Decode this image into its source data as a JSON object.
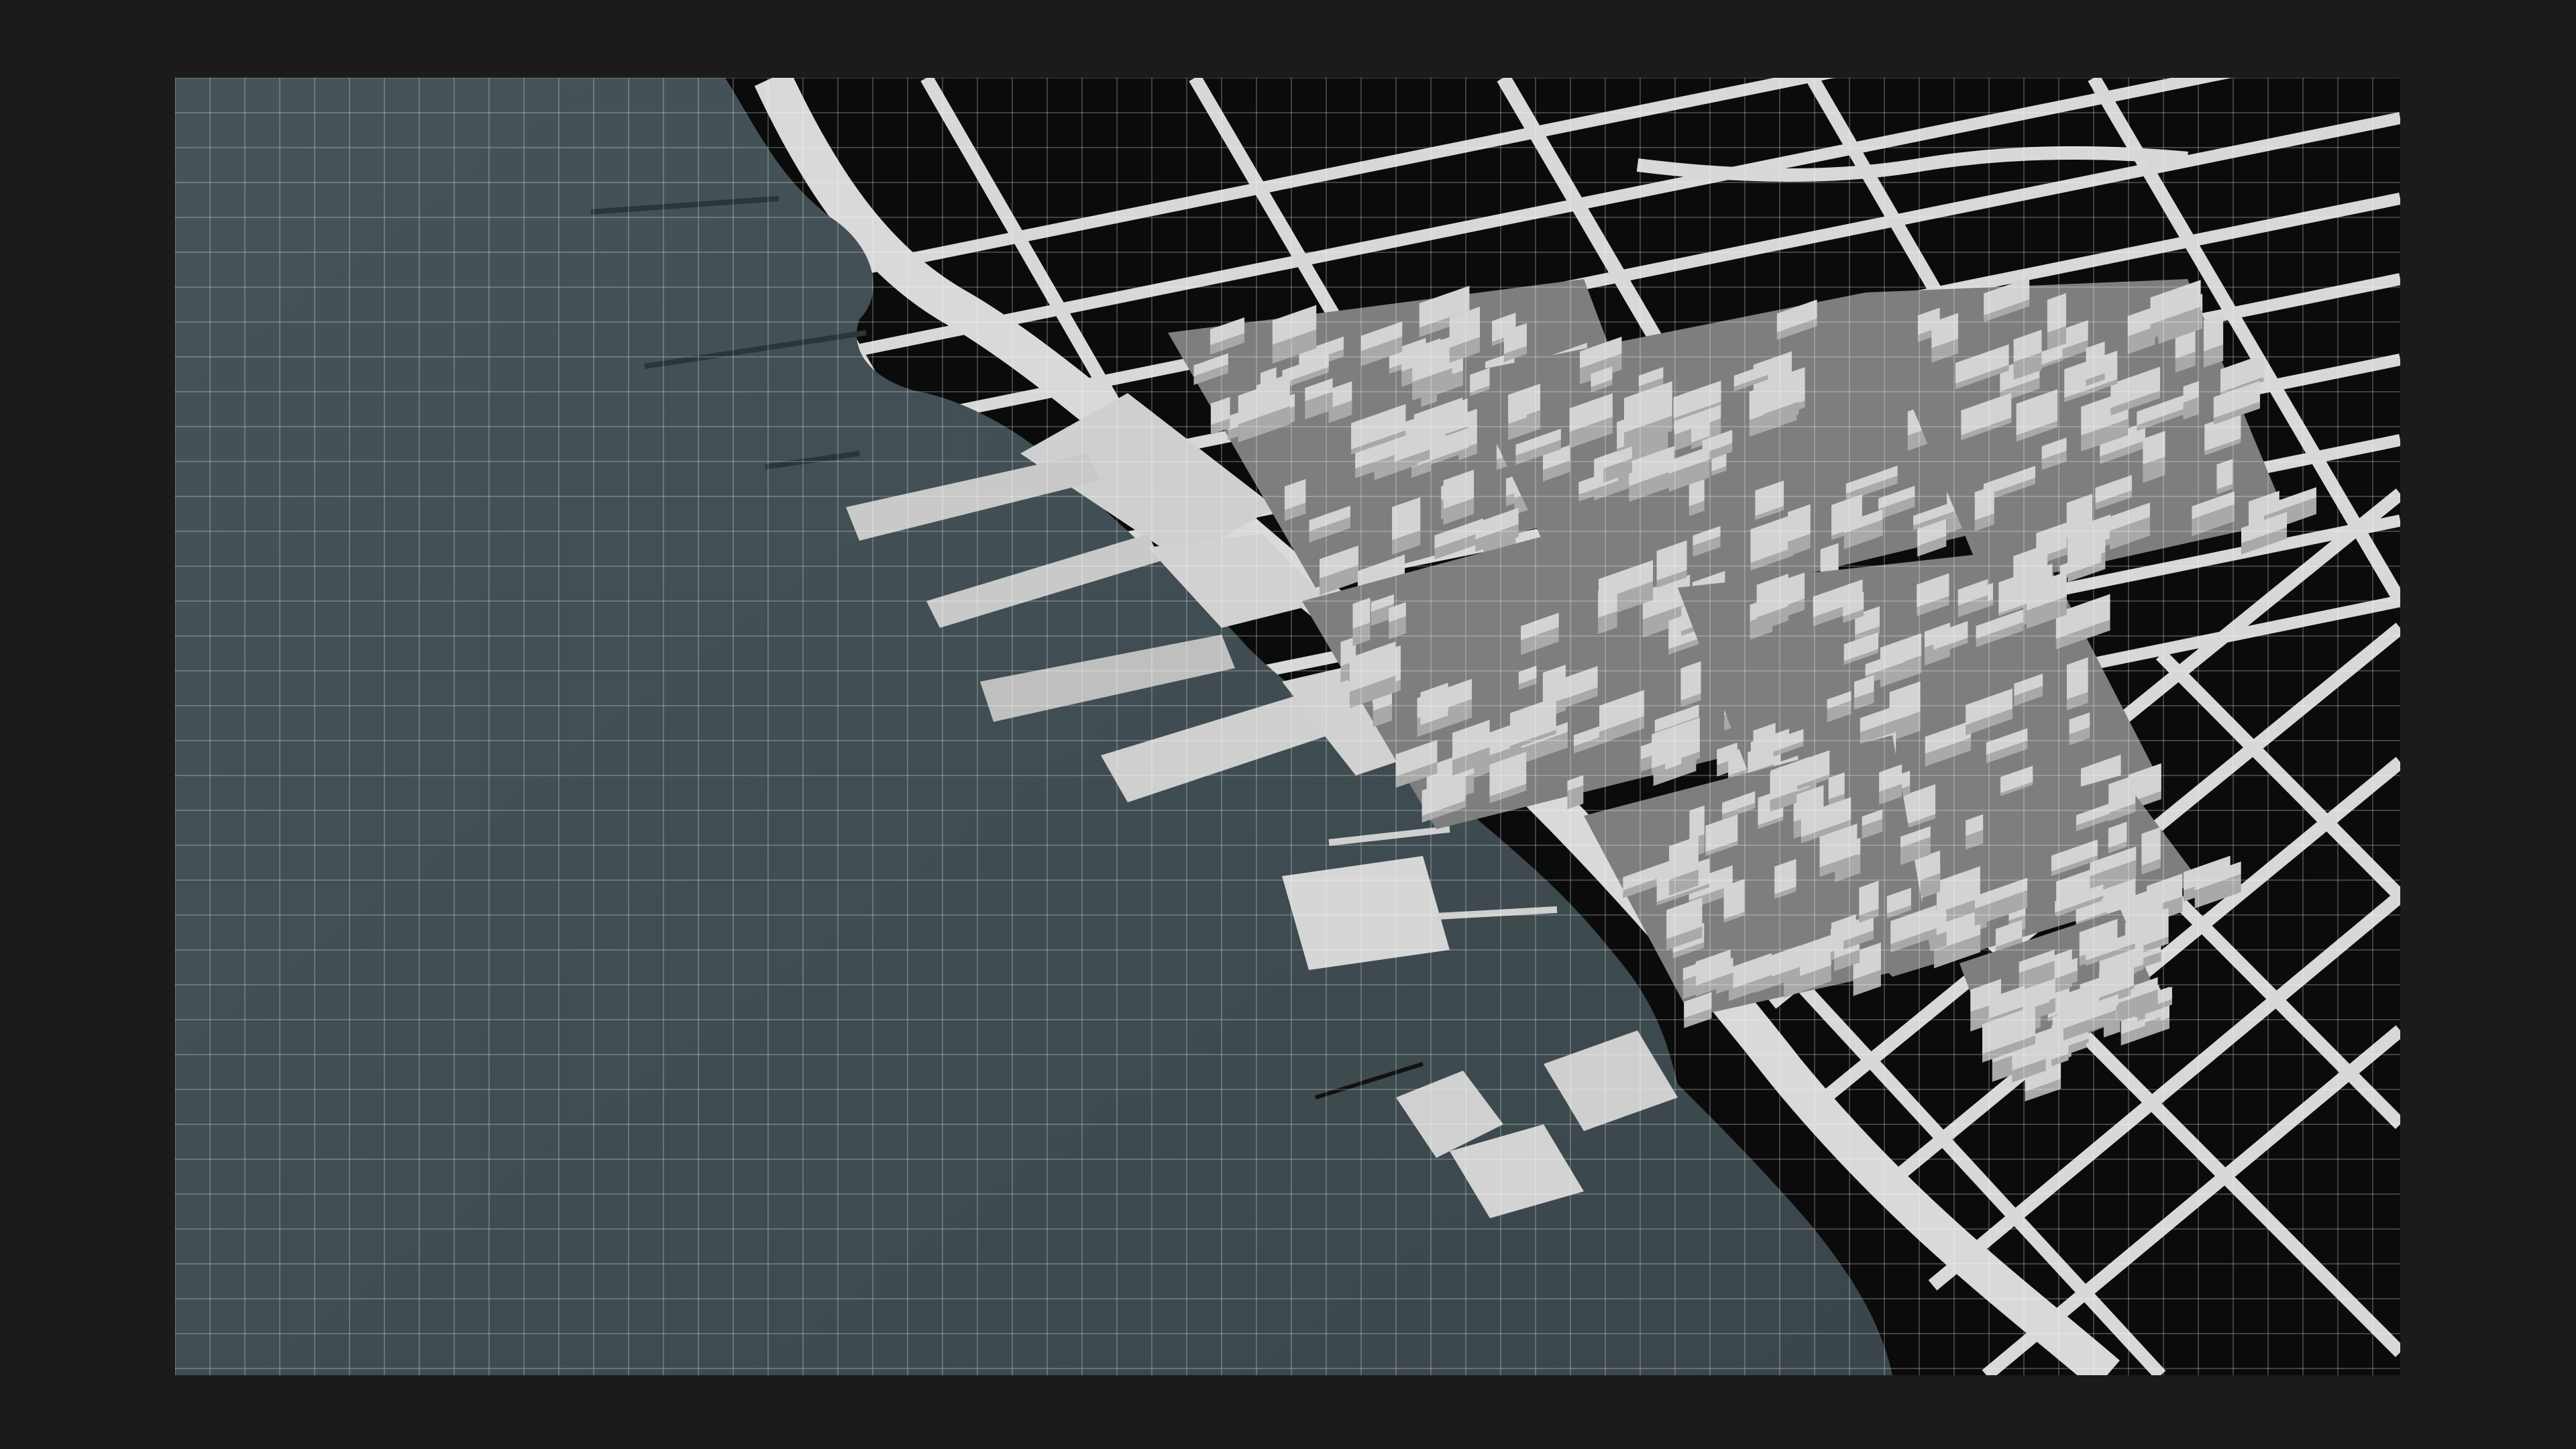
{
  "scene": {
    "kind": "3d-city-waterfront-render",
    "colors": {
      "background": "#1b1b1b",
      "land": "#0b0b0b",
      "water": "#3e4b4f",
      "street": "#dcdcdc",
      "building_top": "#d3d3d3",
      "building_side": "#a9a9a9",
      "building_shadow": "#7e7e7e",
      "grid_line": "#ffffff"
    },
    "grid": {
      "visible": true,
      "spacing_units": 52,
      "opacity": 0.22
    },
    "layers": [
      "water-body",
      "street-network",
      "piers",
      "city-blocks",
      "overlay-grid"
    ]
  }
}
